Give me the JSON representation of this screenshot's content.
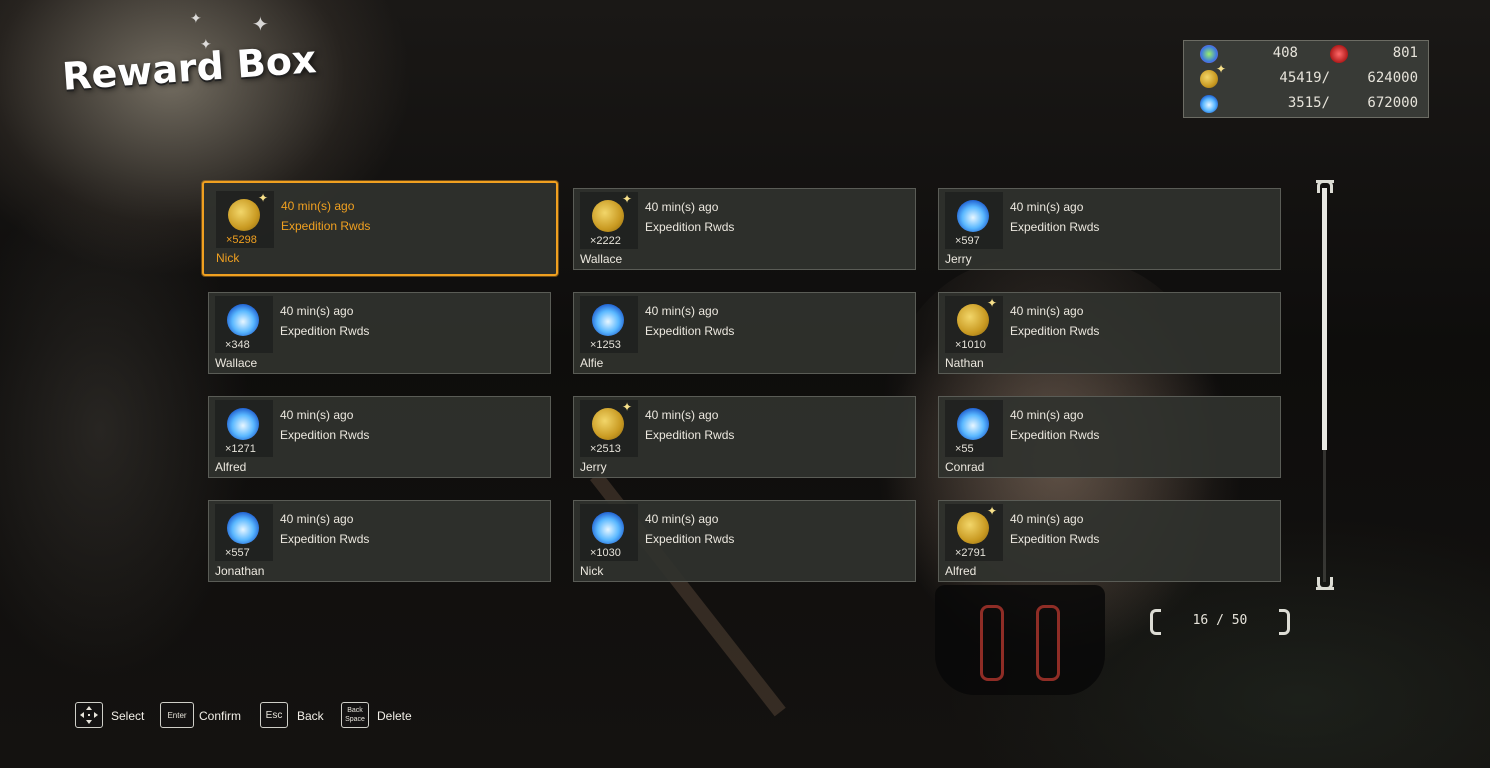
{
  "screen": {
    "title": "Reward Box"
  },
  "currency": {
    "row1": {
      "a": "408",
      "b": "801"
    },
    "row2": {
      "value": "45419/",
      "max": "624000"
    },
    "row3": {
      "value": "3515/",
      "max": "672000"
    }
  },
  "rewards": [
    {
      "icon": "gold-coin-icon",
      "qty": "×5298",
      "time": "40 min(s) ago",
      "desc": "Expedition Rwds",
      "name": "Nick"
    },
    {
      "icon": "gold-coin-icon",
      "qty": "×2222",
      "time": "40 min(s) ago",
      "desc": "Expedition Rwds",
      "name": "Wallace"
    },
    {
      "icon": "blue-wisp-icon",
      "qty": "×597",
      "time": "40 min(s) ago",
      "desc": "Expedition Rwds",
      "name": "Jerry"
    },
    {
      "icon": "blue-wisp-icon",
      "qty": "×348",
      "time": "40 min(s) ago",
      "desc": "Expedition Rwds",
      "name": "Wallace"
    },
    {
      "icon": "blue-wisp-icon",
      "qty": "×1253",
      "time": "40 min(s) ago",
      "desc": "Expedition Rwds",
      "name": "Alfie"
    },
    {
      "icon": "gold-coin-icon",
      "qty": "×1010",
      "time": "40 min(s) ago",
      "desc": "Expedition Rwds",
      "name": "Nathan"
    },
    {
      "icon": "blue-wisp-icon",
      "qty": "×1271",
      "time": "40 min(s) ago",
      "desc": "Expedition Rwds",
      "name": "Alfred"
    },
    {
      "icon": "gold-coin-icon",
      "qty": "×2513",
      "time": "40 min(s) ago",
      "desc": "Expedition Rwds",
      "name": "Jerry"
    },
    {
      "icon": "blue-wisp-icon",
      "qty": "×55",
      "time": "40 min(s) ago",
      "desc": "Expedition Rwds",
      "name": "Conrad"
    },
    {
      "icon": "blue-wisp-icon",
      "qty": "×557",
      "time": "40 min(s) ago",
      "desc": "Expedition Rwds",
      "name": "Jonathan"
    },
    {
      "icon": "blue-wisp-icon",
      "qty": "×1030",
      "time": "40 min(s) ago",
      "desc": "Expedition Rwds",
      "name": "Nick"
    },
    {
      "icon": "gold-coin-icon",
      "qty": "×2791",
      "time": "40 min(s) ago",
      "desc": "Expedition Rwds",
      "name": "Alfred"
    }
  ],
  "pagination": {
    "text": "16 / 50"
  },
  "hints": [
    {
      "key_icon": "dpad-icon",
      "key": "",
      "label": "Select"
    },
    {
      "key_icon": "enter-key-icon",
      "key": "Enter",
      "label": "Confirm"
    },
    {
      "key_icon": "esc-key-icon",
      "key": "Esc",
      "label": "Back"
    },
    {
      "key_icon": "backspace-key-icon",
      "key": "Back Space",
      "label": "Delete"
    }
  ],
  "colors": {
    "selected": "#f0a020",
    "panel": "#30322e"
  }
}
